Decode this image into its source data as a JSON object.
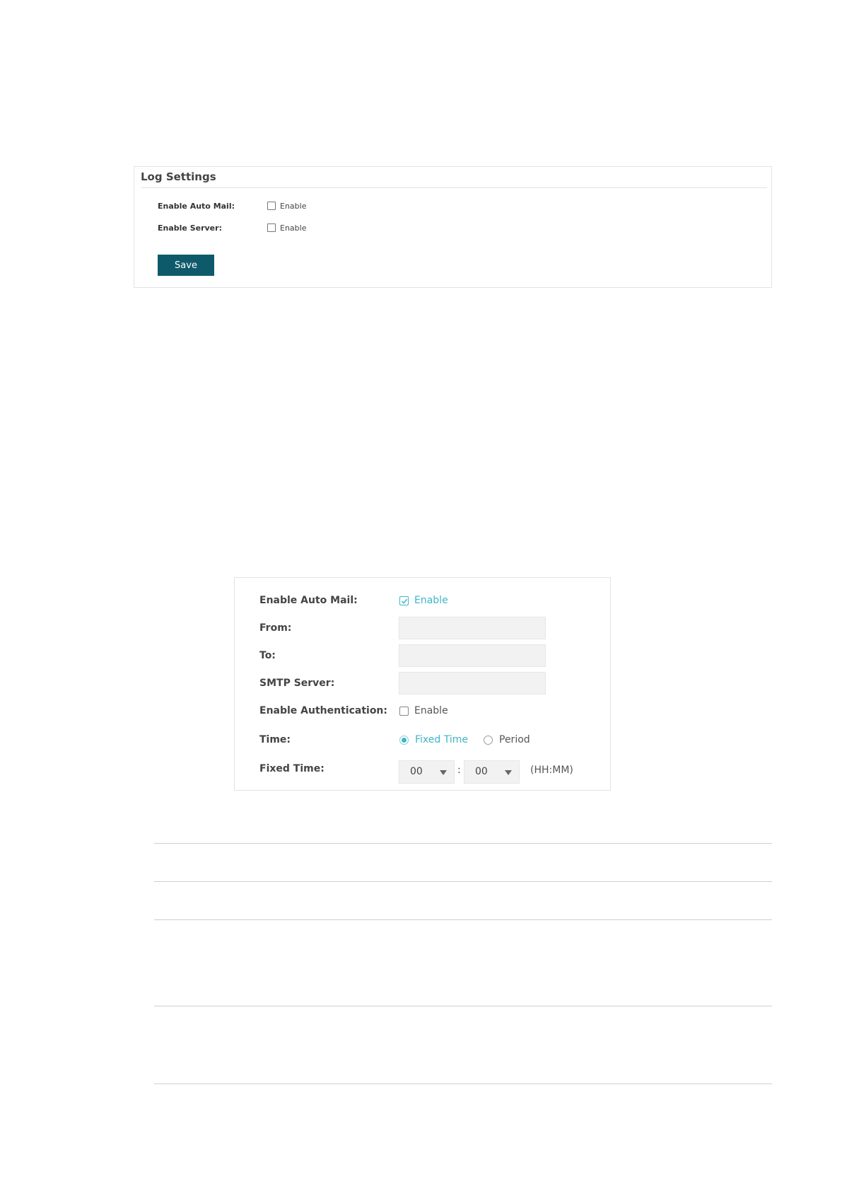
{
  "log_settings": {
    "title": "Log Settings",
    "auto_mail": {
      "label": "Enable Auto Mail:",
      "option": "Enable",
      "checked": false
    },
    "server": {
      "label": "Enable Server:",
      "option": "Enable",
      "checked": false
    },
    "save_label": "Save",
    "save_color": "#0f5a6a"
  },
  "auto_mail_form": {
    "auto_mail": {
      "label": "Enable Auto Mail:",
      "option": "Enable",
      "checked": true
    },
    "from": {
      "label": "From:",
      "value": ""
    },
    "to": {
      "label": "To:",
      "value": ""
    },
    "smtp": {
      "label": "SMTP Server:",
      "value": ""
    },
    "authentication": {
      "label": "Enable Authentication:",
      "option": "Enable",
      "checked": false
    },
    "time": {
      "label": "Time:",
      "options": [
        "Fixed Time",
        "Period"
      ],
      "selected": "Fixed Time"
    },
    "fixed_time": {
      "label": "Fixed Time:",
      "hour": "00",
      "minute": "00",
      "separator": ":",
      "format": "(HH:MM)"
    },
    "accent_color": "#3fb5c6"
  },
  "icons": {
    "checkbox_checked": "check-icon",
    "dropdown": "chevron-down-icon"
  }
}
